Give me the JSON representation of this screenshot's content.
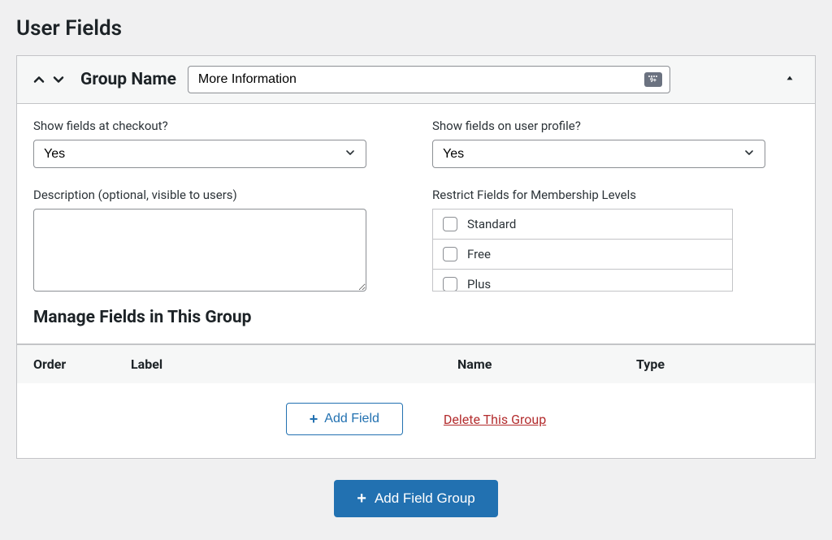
{
  "page": {
    "title": "User Fields"
  },
  "group": {
    "name_label": "Group Name",
    "name_value": "More Information",
    "show_checkout": {
      "label": "Show fields at checkout?",
      "value": "Yes"
    },
    "show_profile": {
      "label": "Show fields on user profile?",
      "value": "Yes"
    },
    "description": {
      "label": "Description (optional, visible to users)",
      "value": ""
    },
    "restrict_levels": {
      "label": "Restrict Fields for Membership Levels",
      "options": [
        "Standard",
        "Free",
        "Plus"
      ]
    },
    "manage_heading": "Manage Fields in This Group"
  },
  "table": {
    "headers": {
      "order": "Order",
      "label": "Label",
      "name": "Name",
      "type": "Type"
    }
  },
  "actions": {
    "add_field": "Add Field",
    "delete_group": "Delete This Group",
    "add_group": "Add Field Group"
  }
}
